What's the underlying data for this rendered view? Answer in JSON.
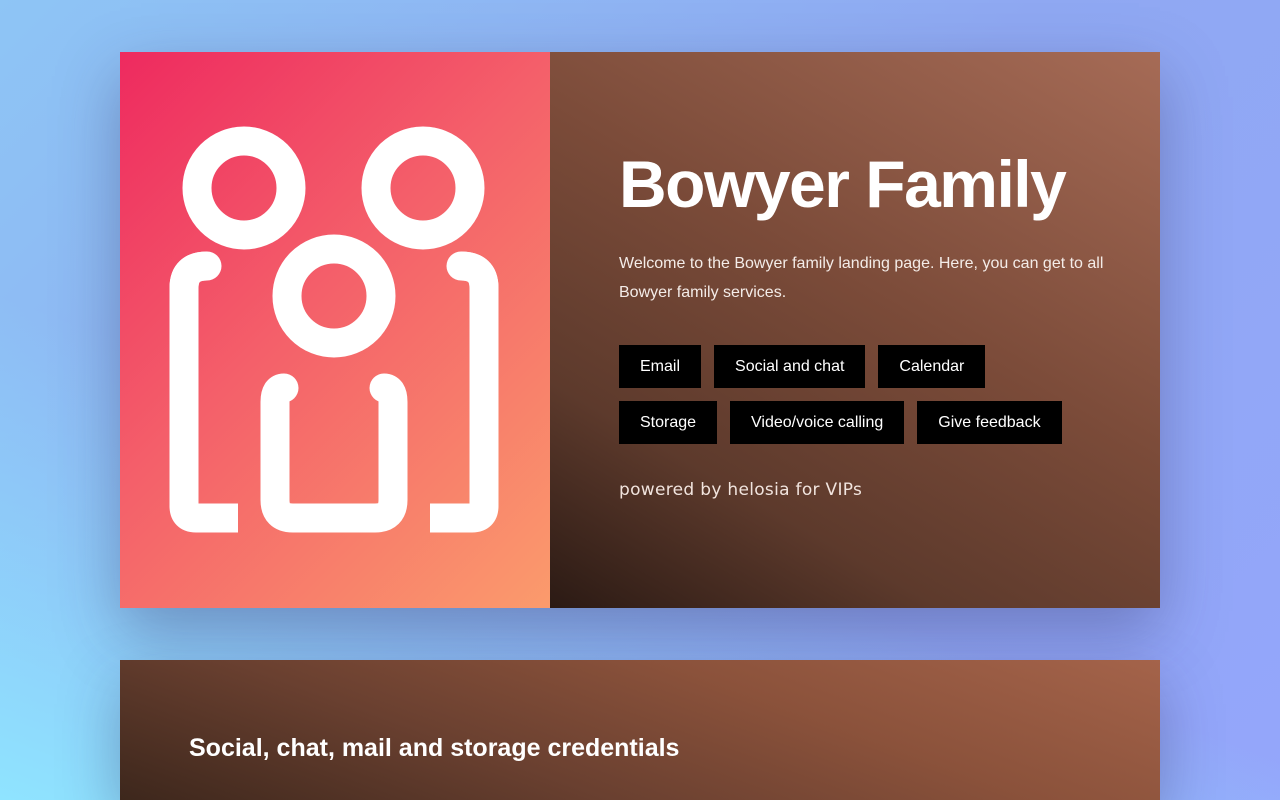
{
  "hero": {
    "title": "Bowyer Family",
    "welcome": "Welcome to the Bowyer family landing page. Here, you can get to all Bowyer family services.",
    "buttons_row1": [
      "Email",
      "Social and chat",
      "Calendar"
    ],
    "buttons_row2": [
      "Storage",
      "Video/voice calling",
      "Give feedback"
    ],
    "powered_by": "powered by helosia for VIPs",
    "logo_icon": "family-group-icon"
  },
  "credentials": {
    "title": "Social, chat, mail and storage credentials"
  },
  "colors": {
    "logo_gradient_start": "#ee2a5f",
    "logo_gradient_end": "#fb9b6c",
    "button_bg": "#000000",
    "button_text": "#ffffff"
  }
}
